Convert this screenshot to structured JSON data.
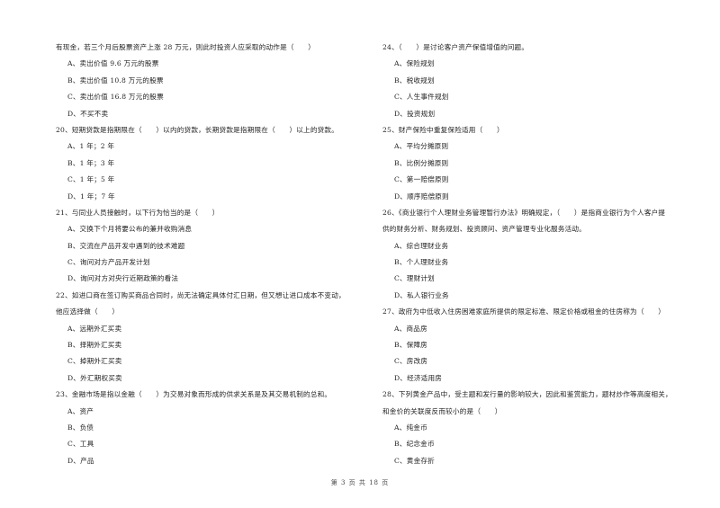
{
  "left_column": [
    {
      "type": "continuation",
      "text": "有现金，若三个月后股票资产上涨 28 万元，则此时投资人应采取的动作是（　　）"
    },
    {
      "type": "option",
      "text": "A、卖出价值 9.6 万元的股票"
    },
    {
      "type": "option",
      "text": "B、卖出价值 10.8 万元的股票"
    },
    {
      "type": "option",
      "text": "C、卖出价值 16.8 万元的股票"
    },
    {
      "type": "option",
      "text": "D、不买不卖"
    },
    {
      "type": "question",
      "text": "20、短期贷款是指期限在（　　）以内的贷款，长期贷款是指期限在（　　）以上的贷款。"
    },
    {
      "type": "option",
      "text": "A、1 年；2 年"
    },
    {
      "type": "option",
      "text": "B、1 年；3 年"
    },
    {
      "type": "option",
      "text": "C、1 年；5 年"
    },
    {
      "type": "option",
      "text": "D、1 年；7 年"
    },
    {
      "type": "question",
      "text": "21、与同业人员接触时，以下行为恰当的是（　　）"
    },
    {
      "type": "option",
      "text": "A、交换下个月将要公布的兼并收购消息"
    },
    {
      "type": "option",
      "text": "B、交流在产品开发中遇到的技术难题"
    },
    {
      "type": "option",
      "text": "C、询问对方产品开发计划"
    },
    {
      "type": "option",
      "text": "D、询问对方对央行近期政策的看法"
    },
    {
      "type": "question",
      "text": "22、如进口商在签订购买商品合同时，尚无法确定具体付汇日期，但又想让进口成本不变动，"
    },
    {
      "type": "continuation",
      "text": "他应选择做（　　）"
    },
    {
      "type": "option",
      "text": "A、远期外汇买卖"
    },
    {
      "type": "option",
      "text": "B、择期外汇买卖"
    },
    {
      "type": "option",
      "text": "C、掉期外汇买卖"
    },
    {
      "type": "option",
      "text": "D、外汇期权买卖"
    },
    {
      "type": "question",
      "text": "23、金融市场是指以金融（　　）为交易对象而形成的供求关系是及其交易机制的总和。"
    },
    {
      "type": "option",
      "text": "A、资产"
    },
    {
      "type": "option",
      "text": "B、负债"
    },
    {
      "type": "option",
      "text": "C、工具"
    },
    {
      "type": "option",
      "text": "D、产品"
    }
  ],
  "right_column": [
    {
      "type": "question",
      "text": "24、（　　）是讨论客户资产保值增值的问题。"
    },
    {
      "type": "option",
      "text": "A、保险规划"
    },
    {
      "type": "option",
      "text": "B、税收规划"
    },
    {
      "type": "option",
      "text": "C、人生事件规划"
    },
    {
      "type": "option",
      "text": "D、投资规划"
    },
    {
      "type": "question",
      "text": "25、财产保险中重复保险适用（　　）"
    },
    {
      "type": "option",
      "text": "A、平均分摊原则"
    },
    {
      "type": "option",
      "text": "B、比例分摊原则"
    },
    {
      "type": "option",
      "text": "C、第一赔偿原则"
    },
    {
      "type": "option",
      "text": "D、顺序赔偿原则"
    },
    {
      "type": "question",
      "text": "26、《商业银行个人理财业务管理暂行办法》明确规定，（　　）是指商业银行为个人客户提"
    },
    {
      "type": "continuation",
      "text": "供的财务分析、财务规划、投资顾问、资产管理专业化服务活动。"
    },
    {
      "type": "option",
      "text": "A、综合理财业务"
    },
    {
      "type": "option",
      "text": "B、个人理财业务"
    },
    {
      "type": "option",
      "text": "C、理财计划"
    },
    {
      "type": "option",
      "text": "D、私人银行业务"
    },
    {
      "type": "question",
      "text": "27、政府为中低收入住房困难家庭所提供的限定标准、限定价格或租金的住房称为（　　）"
    },
    {
      "type": "option",
      "text": "A、商品房"
    },
    {
      "type": "option",
      "text": "B、保障房"
    },
    {
      "type": "option",
      "text": "C、房改房"
    },
    {
      "type": "option",
      "text": "D、经济适用房"
    },
    {
      "type": "question",
      "text": "28、下列黄金产品中，受主题和发行量的影响较大，因此和鉴赏能力，题材炒作等高度相关，"
    },
    {
      "type": "continuation",
      "text": "和金价的关联度反而较小的是（　　）"
    },
    {
      "type": "option",
      "text": "A、纯金币"
    },
    {
      "type": "option",
      "text": "B、纪念金币"
    },
    {
      "type": "option",
      "text": "C、黄金存折"
    }
  ],
  "footer": {
    "text": "第 3 页 共 18 页"
  }
}
